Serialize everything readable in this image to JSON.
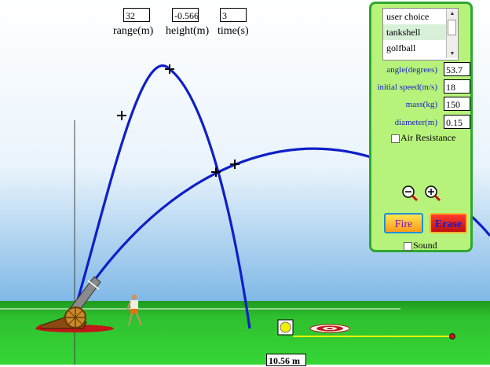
{
  "readouts": {
    "range": {
      "value": "32",
      "label": "range(m)"
    },
    "height": {
      "value": "-0.566",
      "label": "height(m)"
    },
    "time": {
      "value": "3",
      "label": "time(s)"
    }
  },
  "panel": {
    "projectiles": [
      "user choice",
      "tankshell",
      "golfball"
    ],
    "selected_projectile": "tankshell",
    "angle": {
      "label": "angle(degrees)",
      "value": "53.7"
    },
    "initial_speed": {
      "label": "initial speed(m/s)",
      "value": "18"
    },
    "mass": {
      "label": "mass(kg)",
      "value": "150"
    },
    "diameter": {
      "label": "diameter(m)",
      "value": "0.15"
    },
    "air_resistance": {
      "label": "Air Resistance",
      "checked": false
    },
    "fire_label": "Fire",
    "erase_label": "Erase",
    "sound": {
      "label": "Sound",
      "checked": false
    }
  },
  "scene": {
    "tape_reading": "10.56 m",
    "colors": {
      "sky": "#ffffff",
      "ground": "#22b022",
      "trajectory": "#0f1fc8",
      "panel": "#b7f37b"
    }
  }
}
